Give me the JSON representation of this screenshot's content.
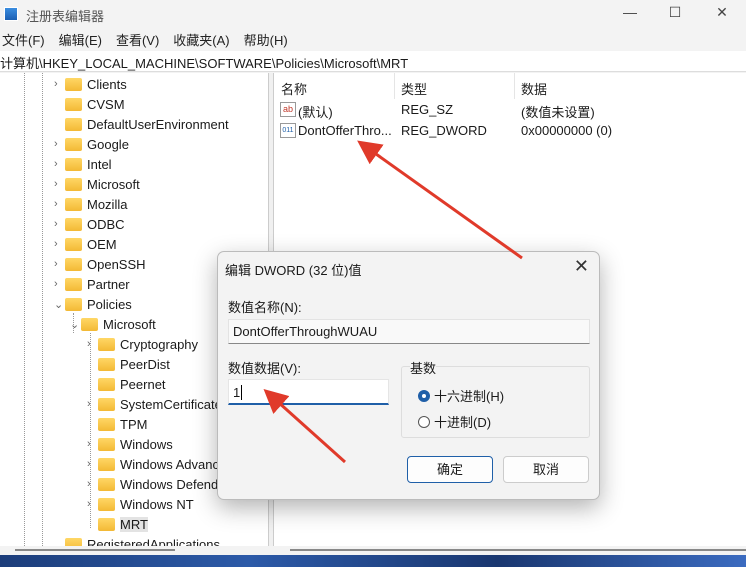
{
  "window": {
    "title": "注册表编辑器",
    "minimize": "—",
    "maximize": "☐",
    "close": "✕"
  },
  "menu": [
    "文件(F)",
    "编辑(E)",
    "查看(V)",
    "收藏夹(A)",
    "帮助(H)"
  ],
  "address": "计算机\\HKEY_LOCAL_MACHINE\\SOFTWARE\\Policies\\Microsoft\\MRT",
  "tree": [
    {
      "label": "Clients",
      "level": 1,
      "chevron": "›"
    },
    {
      "label": "CVSM",
      "level": 1,
      "chevron": ""
    },
    {
      "label": "DefaultUserEnvironment",
      "level": 1,
      "chevron": ""
    },
    {
      "label": "Google",
      "level": 1,
      "chevron": "›"
    },
    {
      "label": "Intel",
      "level": 1,
      "chevron": "›"
    },
    {
      "label": "Microsoft",
      "level": 1,
      "chevron": "›"
    },
    {
      "label": "Mozilla",
      "level": 1,
      "chevron": "›"
    },
    {
      "label": "ODBC",
      "level": 1,
      "chevron": "›"
    },
    {
      "label": "OEM",
      "level": 1,
      "chevron": "›"
    },
    {
      "label": "OpenSSH",
      "level": 1,
      "chevron": "›"
    },
    {
      "label": "Partner",
      "level": 1,
      "chevron": "›"
    },
    {
      "label": "Policies",
      "level": 1,
      "chevron": "⌄"
    },
    {
      "label": "Microsoft",
      "level": 2,
      "chevron": "⌄"
    },
    {
      "label": "Cryptography",
      "level": 3,
      "chevron": "›"
    },
    {
      "label": "PeerDist",
      "level": 3,
      "chevron": ""
    },
    {
      "label": "Peernet",
      "level": 3,
      "chevron": ""
    },
    {
      "label": "SystemCertificate",
      "level": 3,
      "chevron": "›"
    },
    {
      "label": "TPM",
      "level": 3,
      "chevron": ""
    },
    {
      "label": "Windows",
      "level": 3,
      "chevron": "›"
    },
    {
      "label": "Windows Advanc",
      "level": 3,
      "chevron": "›"
    },
    {
      "label": "Windows Defend",
      "level": 3,
      "chevron": "›"
    },
    {
      "label": "Windows NT",
      "level": 3,
      "chevron": "›"
    },
    {
      "label": "MRT",
      "level": 3,
      "chevron": "",
      "selected": true
    },
    {
      "label": "RegisteredApplications",
      "level": 1,
      "chevron": ""
    }
  ],
  "list": {
    "headers": [
      "名称",
      "类型",
      "数据"
    ],
    "rows": [
      {
        "icon": "string-value-icon",
        "icon_text": "ab",
        "name": "(默认)",
        "type": "REG_SZ",
        "data": "(数值未设置)"
      },
      {
        "icon": "binary-value-icon",
        "icon_text": "011",
        "name": "DontOfferThro...",
        "type": "REG_DWORD",
        "data": "0x00000000 (0)"
      }
    ]
  },
  "dialog": {
    "title": "编辑 DWORD (32 位)值",
    "close": "✕",
    "name_label": "数值名称(N):",
    "name_value": "DontOfferThroughWUAU",
    "data_label": "数值数据(V):",
    "data_value": "1",
    "base_label": "基数",
    "radio_hex": "十六进制(H)",
    "radio_dec": "十进制(D)",
    "selected_base": "hex",
    "ok": "确定",
    "cancel": "取消"
  },
  "colors": {
    "accent": "#1f5fa8",
    "annotation_arrow": "#e03a2a"
  }
}
